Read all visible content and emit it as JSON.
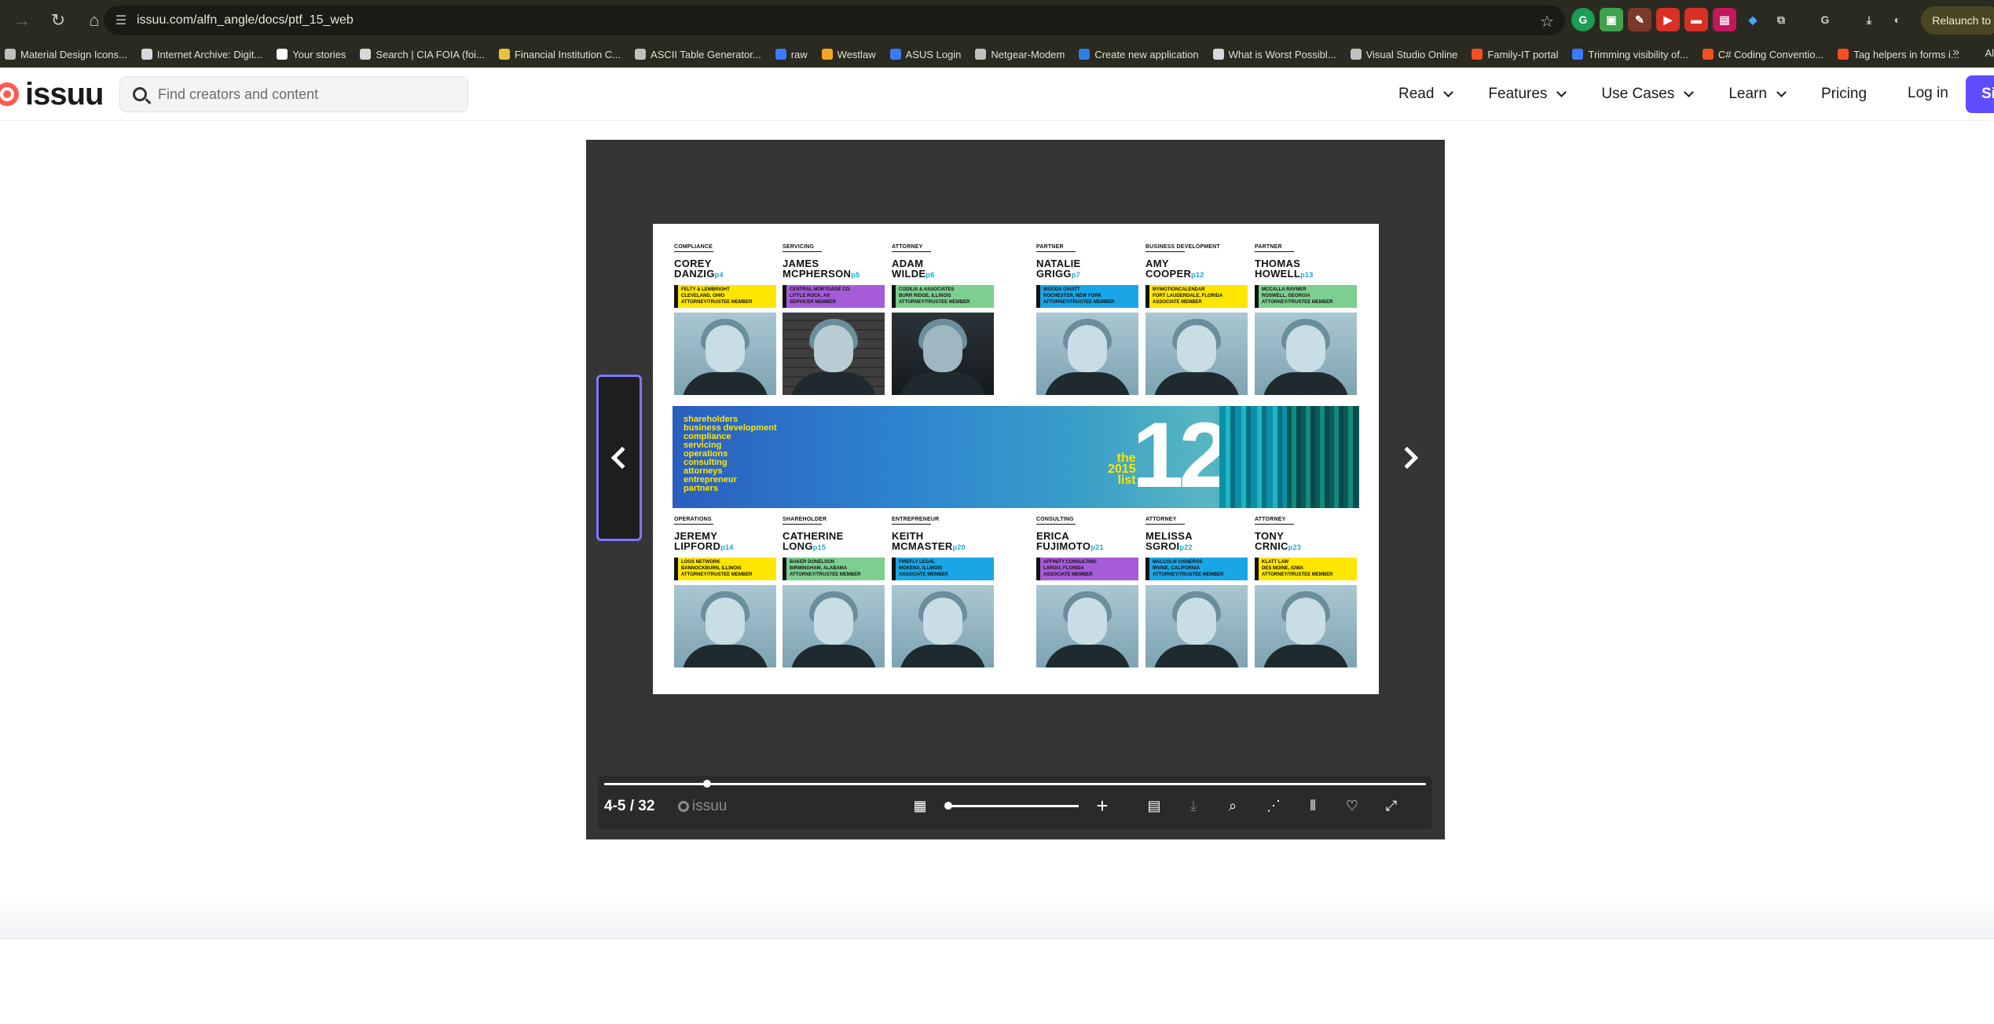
{
  "browser": {
    "url": "issuu.com/alfn_angle/docs/ptf_15_web",
    "relaunch_label": "Relaunch to",
    "bookmarks": [
      {
        "label": "Material Design Icons...",
        "color": "#c0c0c0"
      },
      {
        "label": "Internet Archive: Digit...",
        "color": "#d8d8d8"
      },
      {
        "label": "Your stories",
        "color": "#ffffff"
      },
      {
        "label": "Search | CIA FOIA (foi...",
        "color": "#d8d8d8"
      },
      {
        "label": "Financial Institution C...",
        "color": "#e8c23a"
      },
      {
        "label": "ASCII Table Generator...",
        "color": "#c0c0c0"
      },
      {
        "label": "raw",
        "color": "#3a7bff"
      },
      {
        "label": "Westlaw",
        "color": "#f5a623"
      },
      {
        "label": "ASUS Login",
        "color": "#3a7bff"
      },
      {
        "label": "Netgear-Modem",
        "color": "#c0c0c0"
      },
      {
        "label": "Create new application",
        "color": "#2f7fe0"
      },
      {
        "label": "What is Worst Possibl...",
        "color": "#d8d8d8"
      },
      {
        "label": "Visual Studio Online",
        "color": "#c0c0c0"
      },
      {
        "label": "Family-IT portal",
        "color": "#f25022"
      },
      {
        "label": "Trimming visibility of...",
        "color": "#3a7bff"
      },
      {
        "label": "C# Coding Conventio...",
        "color": "#f25022"
      },
      {
        "label": "Tag helpers in forms i...",
        "color": "#f25022"
      }
    ],
    "bookmarks_all_label": "Al"
  },
  "site": {
    "logo_text": "issuu",
    "search_placeholder": "Find creators and content",
    "menu": [
      {
        "label": "Read",
        "dropdown": true
      },
      {
        "label": "Features",
        "dropdown": true
      },
      {
        "label": "Use Cases",
        "dropdown": true
      },
      {
        "label": "Learn",
        "dropdown": true
      },
      {
        "label": "Pricing",
        "dropdown": false
      }
    ],
    "login_label": "Log in",
    "signup_label": "Si"
  },
  "reader": {
    "page_count": "4-5 / 32",
    "mini_logo_text": "issuu",
    "progress": 0.125,
    "zoom": 0.0
  },
  "spread": {
    "banner_words": [
      "shareholders",
      "business development",
      "compliance",
      "servicing",
      "operations",
      "consulting",
      "attorneys",
      "entrepreneur",
      "partners"
    ],
    "banner_the": "the",
    "banner_year": "2015",
    "banner_list": "list",
    "banner_number": "12",
    "people": [
      {
        "role": "COMPLIANCE",
        "first": "COREY",
        "last": "DANZIG",
        "ref": "p4",
        "tag": [
          "FELTY & LEMBRIGHT",
          "CLEVELAND, OHIO",
          "ATTORNEY/TRUSTEE MEMBER"
        ],
        "tag_color": "#ffe600",
        "photo": "light"
      },
      {
        "role": "SERVICING",
        "first": "JAMES",
        "last": "MCPHERSON",
        "ref": "p5",
        "tag": [
          "CENTRAL MORTGAGE CO.",
          "LITTLE ROCK, AR",
          "SERVICER MEMBER"
        ],
        "tag_color": "#a65bd9",
        "photo": "brick"
      },
      {
        "role": "ATTORNEY",
        "first": "ADAM",
        "last": "WILDE",
        "ref": "p6",
        "tag": [
          "CODILIS & ASSOCIATES",
          "BURR RIDGE, ILLINOIS",
          "ATTORNEY/TRUSTEE MEMBER"
        ],
        "tag_color": "#7ccf8e",
        "photo": "dark"
      },
      {
        "role": "PARTNER",
        "first": "NATALIE",
        "last": "GRIGG",
        "ref": "p7",
        "tag": [
          "WOODS OVIATT",
          "ROCHESTER, NEW YORK",
          "ATTORNEY/TRUSTEE MEMBER"
        ],
        "tag_color": "#1aa6e6",
        "photo": "light"
      },
      {
        "role": "BUSINESS DEVELOPMENT",
        "first": "AMY",
        "last": "COOPER",
        "ref": "p12",
        "tag": [
          "MYMOTIONCALENDAR",
          "FORT LAUDERDALE, FLORIDA",
          "ASSOCIATE MEMBER"
        ],
        "tag_color": "#ffe600",
        "photo": "light"
      },
      {
        "role": "PARTNER",
        "first": "THOMAS",
        "last": "HOWELL",
        "ref": "p13",
        "tag": [
          "MCCALLA RAYMER",
          "ROSWELL, GEORGIA",
          "ATTORNEY/TRUSTEE MEMBER"
        ],
        "tag_color": "#7ccf8e",
        "photo": "light"
      },
      {
        "role": "OPERATIONS",
        "first": "JEREMY",
        "last": "LIPFORD",
        "ref": "p14",
        "tag": [
          "LOGS NETWORK",
          "BANNOCKBURN, ILLINOIS",
          "ATTORNEY/TRUSTEE MEMBER"
        ],
        "tag_color": "#ffe600",
        "photo": "light"
      },
      {
        "role": "SHAREHOLDER",
        "first": "CATHERINE",
        "last": "LONG",
        "ref": "p15",
        "tag": [
          "BAKER DONELSON",
          "BIRMINGHAM, ALABAMA",
          "ATTORNEY/TRUSTEE MEMBER"
        ],
        "tag_color": "#7ccf8e",
        "photo": "light"
      },
      {
        "role": "ENTREPRENEUR",
        "first": "KEITH",
        "last": "MCMASTER",
        "ref": "p20",
        "tag": [
          "FIREFLY LEGAL",
          "MOKENA, ILLINOIS",
          "ASSOCIATE MEMBER"
        ],
        "tag_color": "#1aa6e6",
        "photo": "light"
      },
      {
        "role": "CONSULTING",
        "first": "ERICA",
        "last": "FUJIMOTO",
        "ref": "p21",
        "tag": [
          "AFFINITY CONSULTING",
          "LARGO, FLORIDA",
          "ASSOCIATE MEMBER"
        ],
        "tag_color": "#a65bd9",
        "photo": "light"
      },
      {
        "role": "ATTORNEY",
        "first": "MELISSA",
        "last": "SGROI",
        "ref": "p22",
        "tag": [
          "MALCOLM CISNEROS",
          "IRVINE, CALIFORNIA",
          "ATTORNEY/TRUSTEE MEMBER"
        ],
        "tag_color": "#1aa6e6",
        "photo": "light"
      },
      {
        "role": "ATTORNEY",
        "first": "TONY",
        "last": "CRNIC",
        "ref": "p23",
        "tag": [
          "KLATT LAW",
          "DES MOINE, IOWA",
          "ATTORNEY/TRUSTEE MEMBER"
        ],
        "tag_color": "#ffe600",
        "photo": "light"
      }
    ]
  }
}
